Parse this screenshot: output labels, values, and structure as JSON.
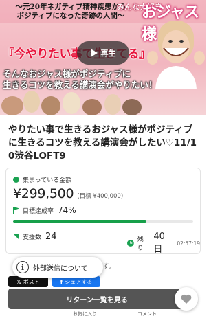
{
  "hero": {
    "kicker_line1": "～元20年ネガティブ精神疾患から",
    "kicker_line2": "ポジティブになった奇跡の人間～",
    "brand_small": "みんな大好き",
    "brand_big": "おジャス様",
    "quote": "『今やりたい事で生きてる』",
    "subtitle_line1": "そんなおジャス様がポジティブに",
    "subtitle_line2": "生きるコツを教える講演会がやりたい！",
    "play_label": "再生"
  },
  "project": {
    "title": "やりたい事で生きるおジャス様がポジティブに生きるコツを教える講演会がしたい♡11/10渋谷LOFT9"
  },
  "funding": {
    "raised_label": "集まっている金額",
    "raised_amount": "¥299,500",
    "goal_text": "(目標 ¥400,000)",
    "achievement_label": "目標達成率",
    "achievement_pct": "74%",
    "achievement_value": 0.74,
    "supporters_label": "支援数",
    "supporters_count": "24",
    "remaining_label": "残り",
    "remaining_days": "40日",
    "remaining_time": "02:57:19"
  },
  "share": {
    "behind_text": "す。",
    "x_label": "ポスト",
    "fb_label": "シェアする"
  },
  "tooltip": {
    "text": "外部送信について"
  },
  "footer": {
    "return_button": "リターン一覧を見る",
    "under_left": "お気に入り",
    "under_right": "コメント"
  },
  "colors": {
    "accent_green": "#1aa251",
    "hero_red": "#e8163d",
    "button_gray": "#555555"
  }
}
